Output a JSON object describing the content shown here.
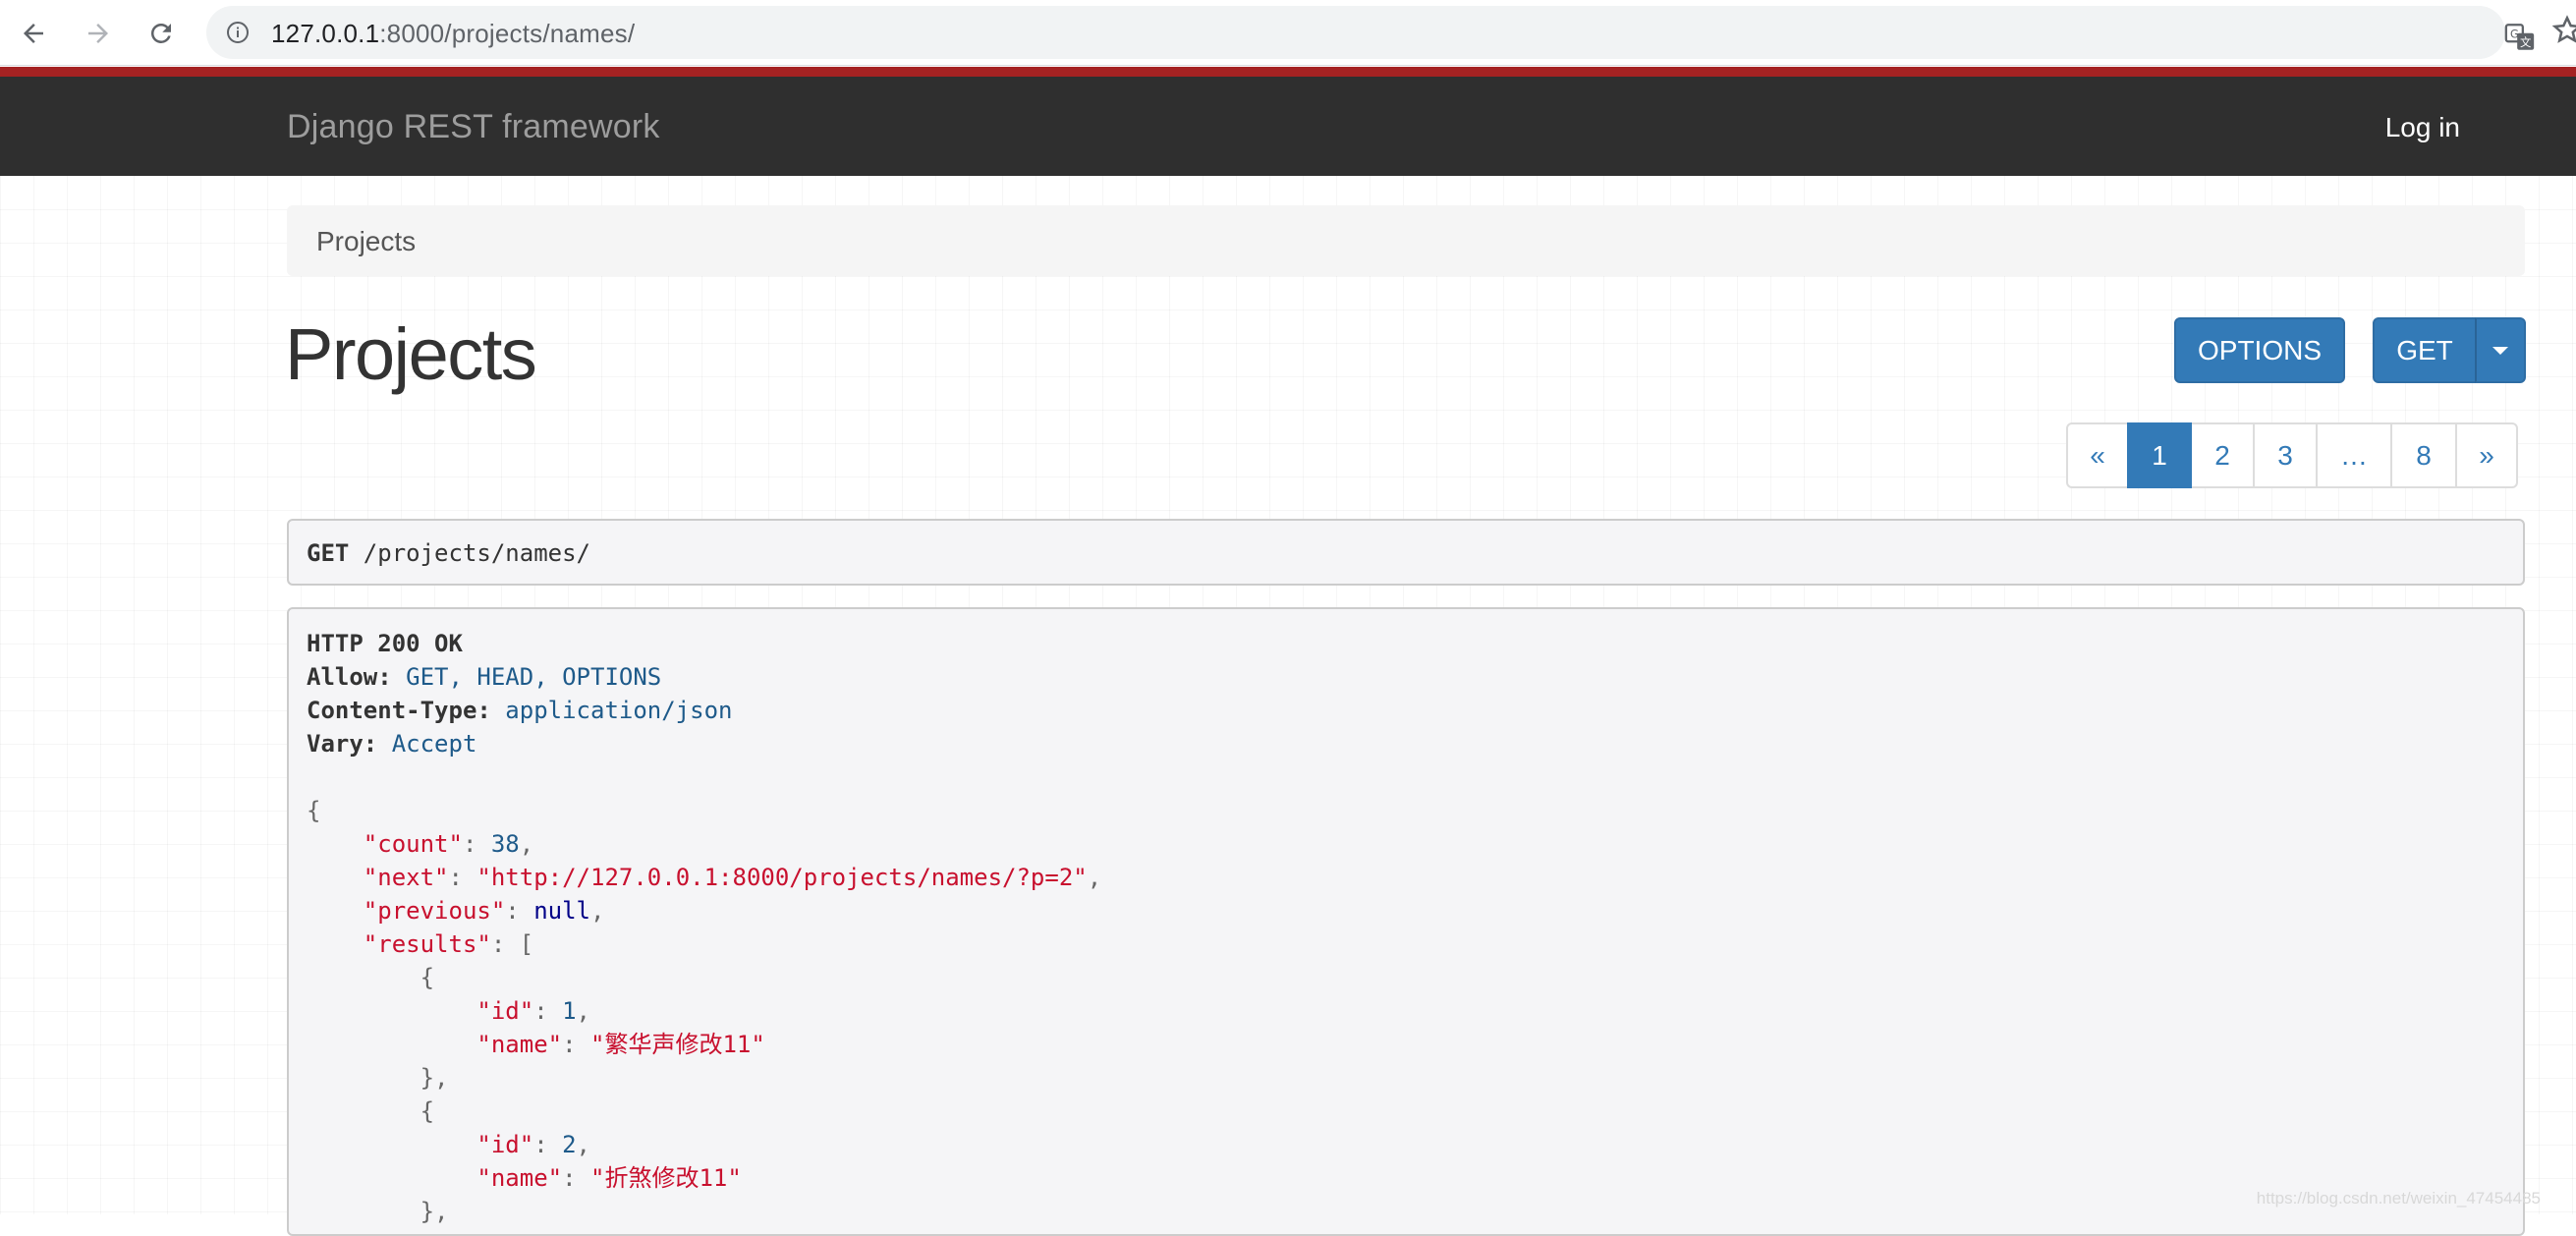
{
  "browser": {
    "url_host": "127.0.0.1",
    "url_rest": ":8000/projects/names/"
  },
  "navbar": {
    "brand": "Django REST framework",
    "login": "Log in"
  },
  "breadcrumb": {
    "label": "Projects"
  },
  "page": {
    "title": "Projects",
    "options_label": "OPTIONS",
    "get_label": "GET"
  },
  "pagination": {
    "prev": "«",
    "pages": [
      "1",
      "2",
      "3",
      "…",
      "8"
    ],
    "next": "»",
    "active": "1"
  },
  "request": {
    "method": "GET",
    "path": " /projects/names/"
  },
  "response": {
    "status": "HTTP 200 OK",
    "headers": [
      {
        "name": "Allow:",
        "value": " GET, HEAD, OPTIONS"
      },
      {
        "name": "Content-Type:",
        "value": " application/json"
      },
      {
        "name": "Vary:",
        "value": " Accept"
      }
    ],
    "json": {
      "count_key": "\"count\"",
      "count": "38",
      "next_key": "\"next\"",
      "next": "\"http://127.0.0.1:8000/projects/names/?p=2\"",
      "previous_key": "\"previous\"",
      "previous": "null",
      "results_key": "\"results\"",
      "id_key": "\"id\"",
      "name_key": "\"name\"",
      "results": [
        {
          "id": "1",
          "name": "\"繁华声修改11\""
        },
        {
          "id": "2",
          "name": "\"折煞修改11\""
        }
      ]
    }
  },
  "watermark": "https://blog.csdn.net/weixin_47454485"
}
